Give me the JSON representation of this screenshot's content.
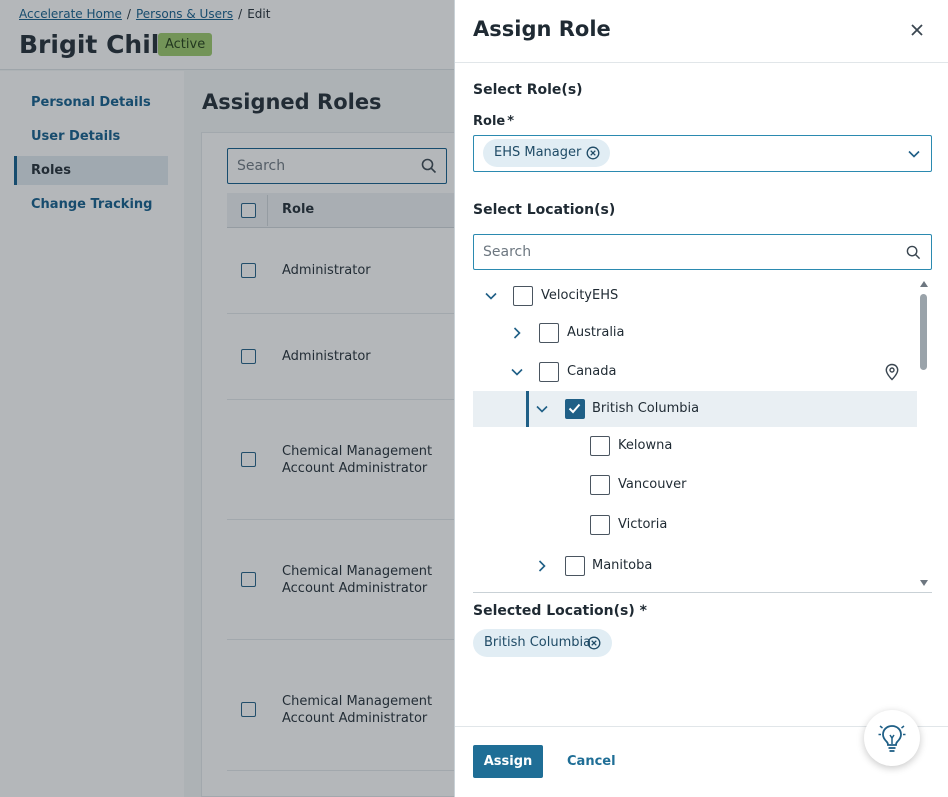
{
  "background": {
    "breadcrumb": {
      "items": [
        "Accelerate Home",
        "Persons & Users",
        "Edit"
      ],
      "separator": "/"
    },
    "person_name": "Brigit Chill",
    "status": "Active",
    "nav": [
      "Personal Details",
      "User Details",
      "Roles",
      "Change Tracking"
    ],
    "active_nav": "Roles",
    "section_title": "Assigned Roles",
    "search_placeholder": "Search",
    "table_header": "Role",
    "rows": [
      {
        "line1": "Administrator",
        "line2": ""
      },
      {
        "line1": "Administrator",
        "line2": ""
      },
      {
        "line1": "Chemical Management",
        "line2": "Account Administrator"
      },
      {
        "line1": "Chemical Management",
        "line2": "Account Administrator"
      },
      {
        "line1": "Chemical Management",
        "line2": "Account Administrator"
      }
    ]
  },
  "drawer": {
    "title": "Assign Role",
    "select_roles_heading": "Select Role(s)",
    "role_label": "Role",
    "required_mark": "*",
    "selected_role_chip": "EHS Manager",
    "select_locations_heading": "Select Location(s)",
    "location_search_placeholder": "Search",
    "tree": [
      {
        "label": "VelocityEHS",
        "level": 0,
        "expanded": true,
        "checked": false
      },
      {
        "label": "Australia",
        "level": 1,
        "expanded": false,
        "checked": false
      },
      {
        "label": "Canada",
        "level": 1,
        "expanded": true,
        "checked": false,
        "has_pin": true
      },
      {
        "label": "British Columbia",
        "level": 2,
        "expanded": true,
        "checked": true,
        "selected": true
      },
      {
        "label": "Kelowna",
        "level": 3,
        "checked": false
      },
      {
        "label": "Vancouver",
        "level": 3,
        "checked": false
      },
      {
        "label": "Victoria",
        "level": 3,
        "checked": false
      },
      {
        "label": "Manitoba",
        "level": 2,
        "expanded": false,
        "checked": false
      }
    ],
    "selected_locations_heading": "Selected Location(s) *",
    "selected_location_chip": "British Columbia",
    "assign_label": "Assign",
    "cancel_label": "Cancel"
  },
  "colors": {
    "primary": "#1f6e96",
    "link": "#0f5b8a",
    "badge_active": "#9cc969",
    "chip_bg": "#e1edf4"
  }
}
